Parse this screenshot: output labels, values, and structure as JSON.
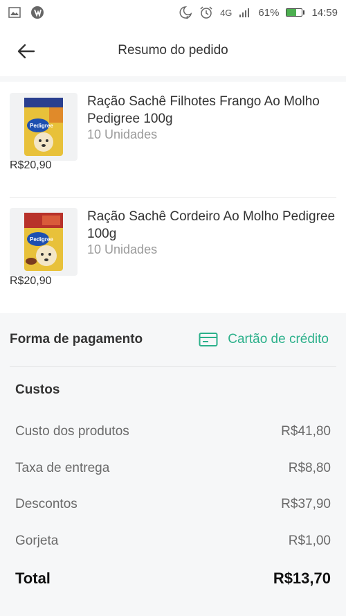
{
  "status_bar": {
    "network": "4G",
    "battery_percent": "61%",
    "battery_level": 0.61,
    "time": "14:59",
    "icons": [
      "image-icon",
      "app-logo-icon",
      "moon-icon",
      "alarm-icon",
      "signal-icon",
      "battery-icon"
    ]
  },
  "header": {
    "title": "Resumo do pedido",
    "back_icon": "arrow-left-icon"
  },
  "products": [
    {
      "name": "Ração Sachê Filhotes Frango Ao Molho Pedigree 100g",
      "quantity": "10 Unidades",
      "price": "R$20,90"
    },
    {
      "name": "Ração Sachê Cordeiro Ao Molho Pedigree 100g",
      "quantity": "10 Unidades",
      "price": "R$20,90"
    }
  ],
  "payment": {
    "label": "Forma de pagamento",
    "method": "Cartão de crédito",
    "method_icon": "credit-card-icon",
    "accent_color": "#2bb08a"
  },
  "costs": {
    "title": "Custos",
    "rows": [
      {
        "label": "Custo dos produtos",
        "value": "R$41,80"
      },
      {
        "label": "Taxa de entrega",
        "value": "R$8,80"
      },
      {
        "label": "Descontos",
        "value": "R$37,90"
      },
      {
        "label": "Gorjeta",
        "value": "R$1,00"
      }
    ],
    "total_label": "Total",
    "total_value": "R$13,70"
  }
}
